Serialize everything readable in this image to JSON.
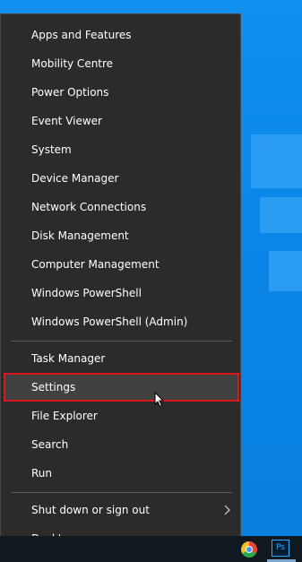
{
  "menu": {
    "group1": [
      {
        "label": "Apps and Features"
      },
      {
        "label": "Mobility Centre"
      },
      {
        "label": "Power Options"
      },
      {
        "label": "Event Viewer"
      },
      {
        "label": "System"
      },
      {
        "label": "Device Manager"
      },
      {
        "label": "Network Connections"
      },
      {
        "label": "Disk Management"
      },
      {
        "label": "Computer Management"
      },
      {
        "label": "Windows PowerShell"
      },
      {
        "label": "Windows PowerShell (Admin)"
      }
    ],
    "group2": [
      {
        "label": "Task Manager"
      },
      {
        "label": "Settings",
        "selected": true
      },
      {
        "label": "File Explorer"
      },
      {
        "label": "Search"
      },
      {
        "label": "Run"
      }
    ],
    "group3": [
      {
        "label": "Shut down or sign out",
        "has_submenu": true
      },
      {
        "label": "Desktop"
      }
    ]
  },
  "taskbar": {
    "icons": [
      "chrome-icon",
      "photoshop-icon"
    ],
    "photoshop_label": "Ps"
  },
  "colors": {
    "menu_bg": "#2b2b2b",
    "selection_outline": "#d9171c",
    "desktop_bg": "#0a84e6"
  }
}
